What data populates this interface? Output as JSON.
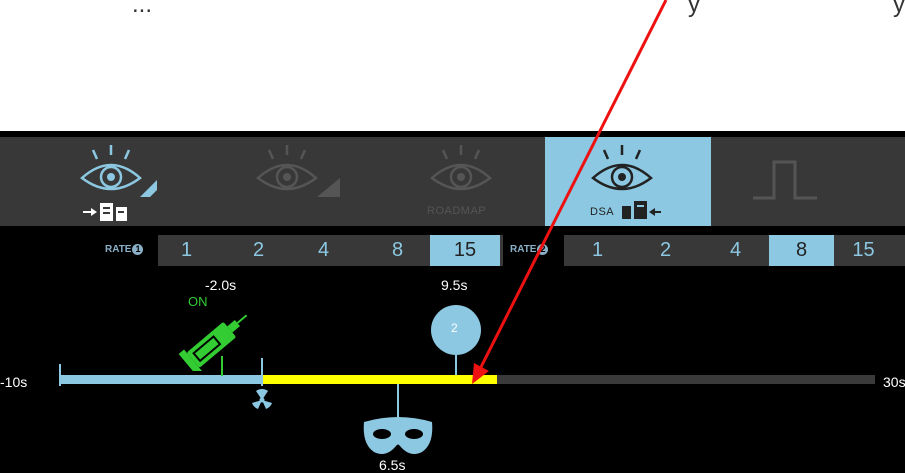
{
  "colors": {
    "accent": "#8cc8e2",
    "bar_dark": "#383838",
    "timeline_bg": "#3a3a3a",
    "timeline_blue": "#8cc8e2",
    "timeline_yellow": "#ffff00",
    "injector_green": "#33cc33",
    "arrow_red": "#ee1111"
  },
  "caption": {
    "left": "...",
    "mid": "y",
    "right": "y"
  },
  "modes": [
    {
      "name": "fluoro-store-mode",
      "label": "",
      "state": "enabled"
    },
    {
      "name": "fluoro-mode",
      "label": "",
      "state": "dimmed"
    },
    {
      "name": "roadmap-mode",
      "label": "ROADMAP",
      "state": "dimmed"
    },
    {
      "name": "dsa-mode",
      "label": "DSA",
      "state": "selected"
    },
    {
      "name": "pulse-mode",
      "label": "",
      "state": "dimmed"
    }
  ],
  "rate1": {
    "label": "RATE",
    "badge": "1",
    "values": [
      "1",
      "2",
      "4",
      "8",
      "15"
    ],
    "selected": "15"
  },
  "rate2": {
    "label": "RATE",
    "badge": "2",
    "values": [
      "1",
      "2",
      "4",
      "8",
      "15"
    ],
    "selected": "8"
  },
  "timeline": {
    "start_label": "-10s",
    "end_label": "30s",
    "injection_time_label": "-2.0s",
    "injection_state": "ON",
    "phase_marker_time_label": "9.5s",
    "phase_marker_number": "2",
    "mask_time_label": "6.5s",
    "icons": [
      "syringe-icon",
      "radiation-icon",
      "mask-icon",
      "red-arrow"
    ]
  }
}
